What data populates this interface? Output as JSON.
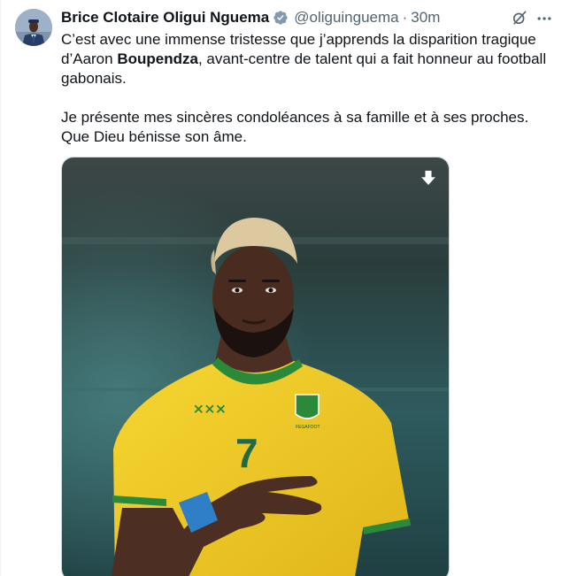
{
  "tweet": {
    "author": {
      "name": "Brice Clotaire Oligui Nguema",
      "handle": "@oliguinguema",
      "separator": "·",
      "time": "30m",
      "avatar_icon": "avatar-portrait",
      "verified_icon": "verified-badge-icon",
      "verified_color": "#829aab"
    },
    "text": {
      "p1_before": "C’est avec une immense tristesse que j’apprends la disparition tragique d’Aaron ",
      "p1_bold": "Boupendza",
      "p1_after": ", avant-centre de talent qui a fait honneur au football gabonais.",
      "p2": "Je présente mes sincères condoléances à sa famille et à ses proches. Que Dieu bénisse son âme."
    },
    "actions": {
      "grok_icon": "grok-icon",
      "more_icon": "more-options-icon"
    },
    "media": {
      "type": "photo",
      "jersey_number": "7",
      "crest_text": "FEGAFOOT",
      "download_icon": "download-icon",
      "jersey_color": "#f3cc26",
      "trim_color": "#2a8a3a",
      "background_color": "#2f4a4f"
    }
  }
}
